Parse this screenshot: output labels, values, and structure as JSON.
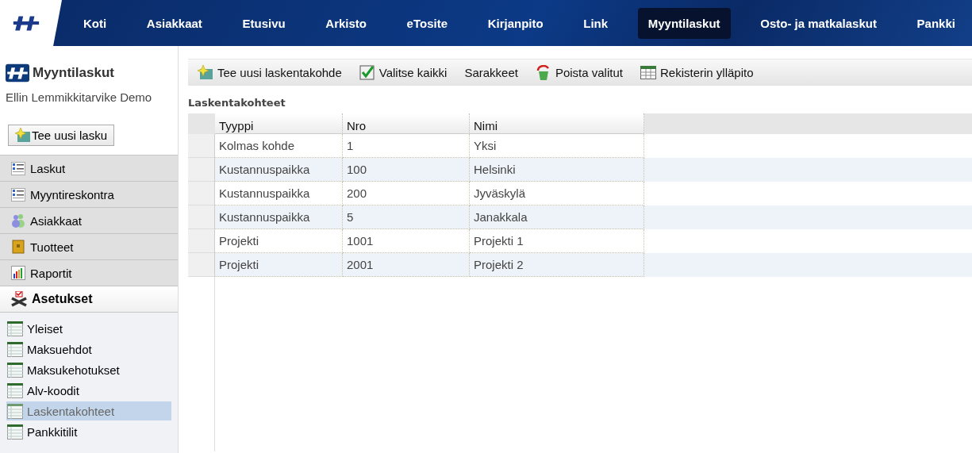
{
  "nav": {
    "items": [
      {
        "label": "Koti",
        "selected": false
      },
      {
        "label": "Asiakkaat",
        "selected": false
      },
      {
        "label": "Etusivu",
        "selected": false
      },
      {
        "label": "Arkisto",
        "selected": false
      },
      {
        "label": "eTosite",
        "selected": false
      },
      {
        "label": "Kirjanpito",
        "selected": false
      },
      {
        "label": "Link",
        "selected": false
      },
      {
        "label": "Myyntilaskut",
        "selected": true
      },
      {
        "label": "Osto- ja matkalaskut",
        "selected": false
      },
      {
        "label": "Pankki",
        "selected": false
      }
    ]
  },
  "sidebar": {
    "title": "Myyntilaskut",
    "company": "Ellin Lemmikkitarvike Demo",
    "new_button": "Tee uusi lasku",
    "sections": [
      {
        "label": "Laskut",
        "kind": "list",
        "expanded": false
      },
      {
        "label": "Myyntireskontra",
        "kind": "list",
        "expanded": false
      },
      {
        "label": "Asiakkaat",
        "kind": "people",
        "expanded": false
      },
      {
        "label": "Tuotteet",
        "kind": "box",
        "expanded": false
      },
      {
        "label": "Raportit",
        "kind": "chart",
        "expanded": false
      },
      {
        "label": "Asetukset",
        "kind": "tools",
        "expanded": true,
        "children": [
          {
            "label": "Yleiset",
            "selected": false
          },
          {
            "label": "Maksuehdot",
            "selected": false
          },
          {
            "label": "Maksukehotukset",
            "selected": false
          },
          {
            "label": "Alv-koodit",
            "selected": false
          },
          {
            "label": "Laskentakohteet",
            "selected": true
          },
          {
            "label": "Pankkitilit",
            "selected": false
          }
        ]
      }
    ]
  },
  "toolbar": [
    {
      "label": "Tee uusi laskentakohde",
      "kind": "new"
    },
    {
      "label": "Valitse kaikki",
      "kind": "check"
    },
    {
      "label": "Sarakkeet",
      "kind": "plain"
    },
    {
      "label": "Poista valitut",
      "kind": "delete"
    },
    {
      "label": "Rekisterin ylläpito",
      "kind": "table"
    }
  ],
  "table": {
    "title": "Laskentakohteet",
    "columns": [
      "Tyyppi",
      "Nro",
      "Nimi"
    ],
    "rows": [
      [
        "Kolmas kohde",
        "1",
        "Yksi"
      ],
      [
        "Kustannuspaikka",
        "100",
        "Helsinki"
      ],
      [
        "Kustannuspaikka",
        "200",
        "Jyväskylä"
      ],
      [
        "Kustannuspaikka",
        "5",
        "Janakkala"
      ],
      [
        "Projekti",
        "1001",
        "Projekti 1"
      ],
      [
        "Projekti",
        "2001",
        "Projekti 2"
      ]
    ]
  }
}
